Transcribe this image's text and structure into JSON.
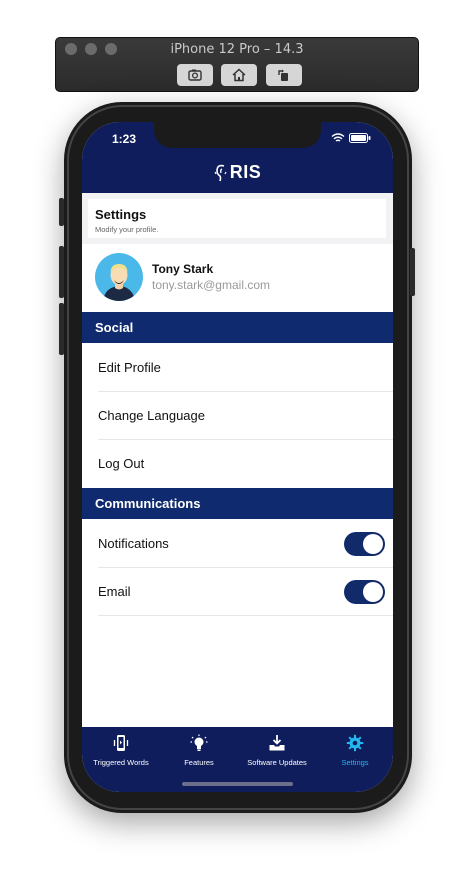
{
  "simulator": {
    "title": "iPhone 12 Pro – 14.3"
  },
  "status_bar": {
    "time": "1:23"
  },
  "header": {
    "logo_text": "RIS"
  },
  "settings_card": {
    "title": "Settings",
    "subtitle": "Modify your profile."
  },
  "profile": {
    "name": "Tony Stark",
    "email": "tony.stark@gmail.com"
  },
  "sections": {
    "social": {
      "title": "Social",
      "items": [
        {
          "label": "Edit Profile"
        },
        {
          "label": "Change Language"
        },
        {
          "label": "Log Out"
        }
      ]
    },
    "communications": {
      "title": "Communications",
      "items": [
        {
          "label": "Notifications",
          "enabled": true
        },
        {
          "label": "Email",
          "enabled": true
        }
      ]
    }
  },
  "tabs": [
    {
      "label": "Triggered Words",
      "icon": "phone-vibrate-icon",
      "active": false
    },
    {
      "label": "Features",
      "icon": "lightbulb-icon",
      "active": false
    },
    {
      "label": "Software Updates",
      "icon": "download-tray-icon",
      "active": false
    },
    {
      "label": "Settings",
      "icon": "gear-icon",
      "active": true
    }
  ],
  "colors": {
    "primary": "#0f1d5c",
    "section": "#0f2a6e",
    "accent": "#22b8f0"
  }
}
